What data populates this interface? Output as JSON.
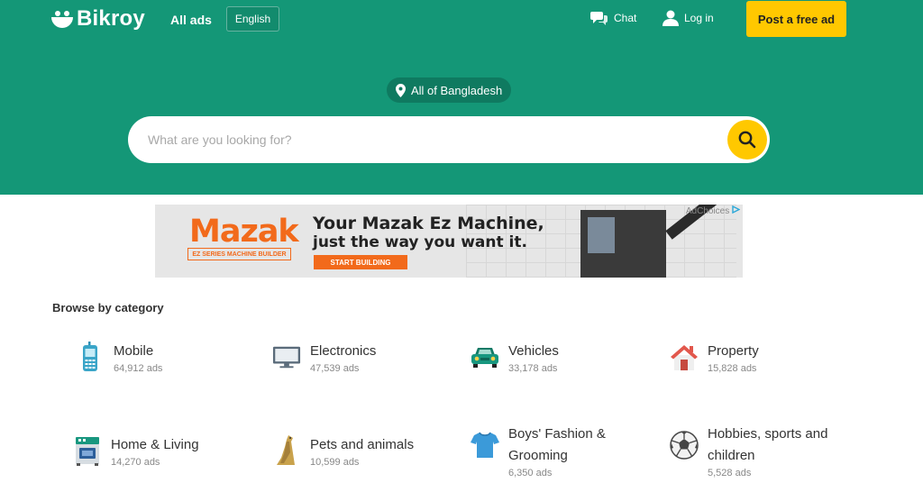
{
  "header": {
    "logo_text": "Bikroy",
    "all_ads": "All ads",
    "language": "English",
    "chat": "Chat",
    "login": "Log in",
    "post_ad": "Post a free ad"
  },
  "hero": {
    "location": "All of Bangladesh",
    "search_placeholder": "What are you looking for?"
  },
  "ad": {
    "brand": "Mazak",
    "brand_sub": "EZ SERIES MACHINE BUILDER",
    "headline_1": "Your Mazak Ez Machine,",
    "headline_2": "just the way you want it.",
    "cta": "START BUILDING",
    "adchoices": "AdChoices"
  },
  "browse": {
    "title": "Browse by category",
    "categories": [
      {
        "name": "Mobile",
        "count": "64,912 ads",
        "icon": "mobile-icon"
      },
      {
        "name": "Electronics",
        "count": "47,539 ads",
        "icon": "monitor-icon"
      },
      {
        "name": "Vehicles",
        "count": "33,178 ads",
        "icon": "car-icon"
      },
      {
        "name": "Property",
        "count": "15,828 ads",
        "icon": "house-icon"
      },
      {
        "name": "Home & Living",
        "count": "14,270 ads",
        "icon": "furniture-icon"
      },
      {
        "name": "Pets and animals",
        "count": "10,599 ads",
        "icon": "pet-icon"
      },
      {
        "name": "Boys' Fashion & Grooming",
        "count": "6,350 ads",
        "icon": "tshirt-icon"
      },
      {
        "name": "Hobbies, sports and children",
        "count": "5,528 ads",
        "icon": "football-icon"
      }
    ]
  },
  "colors": {
    "brand_green": "#149777",
    "accent_yellow": "#ffc800"
  }
}
